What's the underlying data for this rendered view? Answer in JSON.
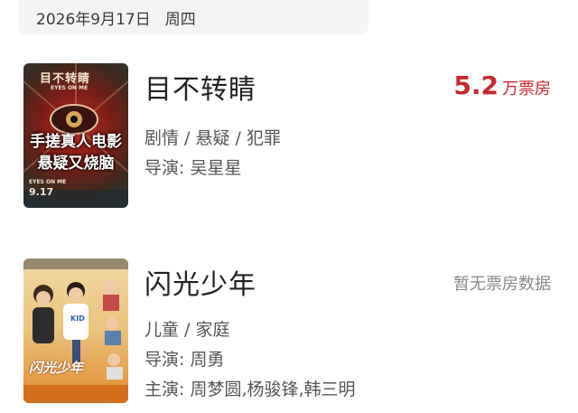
{
  "header": {
    "date": "2026年9月17日",
    "weekday": "周四"
  },
  "movies": [
    {
      "title": "目不转睛",
      "box_value": "5.2",
      "box_unit": "万票房",
      "genre": "剧情 / 悬疑 / 犯罪",
      "director": "导演: 吴星星",
      "poster": {
        "title_text": "目不转睛",
        "subtitle_text": "EYES ON ME",
        "overlay_line1": "手搓真人电影",
        "overlay_line2": "悬疑又烧脑",
        "date_text": "9.17",
        "corner_text": "EYES ON ME"
      }
    },
    {
      "title": "闪光少年",
      "no_box": "暂无票房数据",
      "genre": "儿童 / 家庭",
      "director": "导演: 周勇",
      "cast": "主演: 周梦圆,杨骏锋,韩三明",
      "poster": {
        "shirt_text": "KID",
        "title_text": "闪光少年"
      }
    }
  ],
  "colors": {
    "accent": "#c8272f",
    "muted": "#8a8a8a"
  }
}
